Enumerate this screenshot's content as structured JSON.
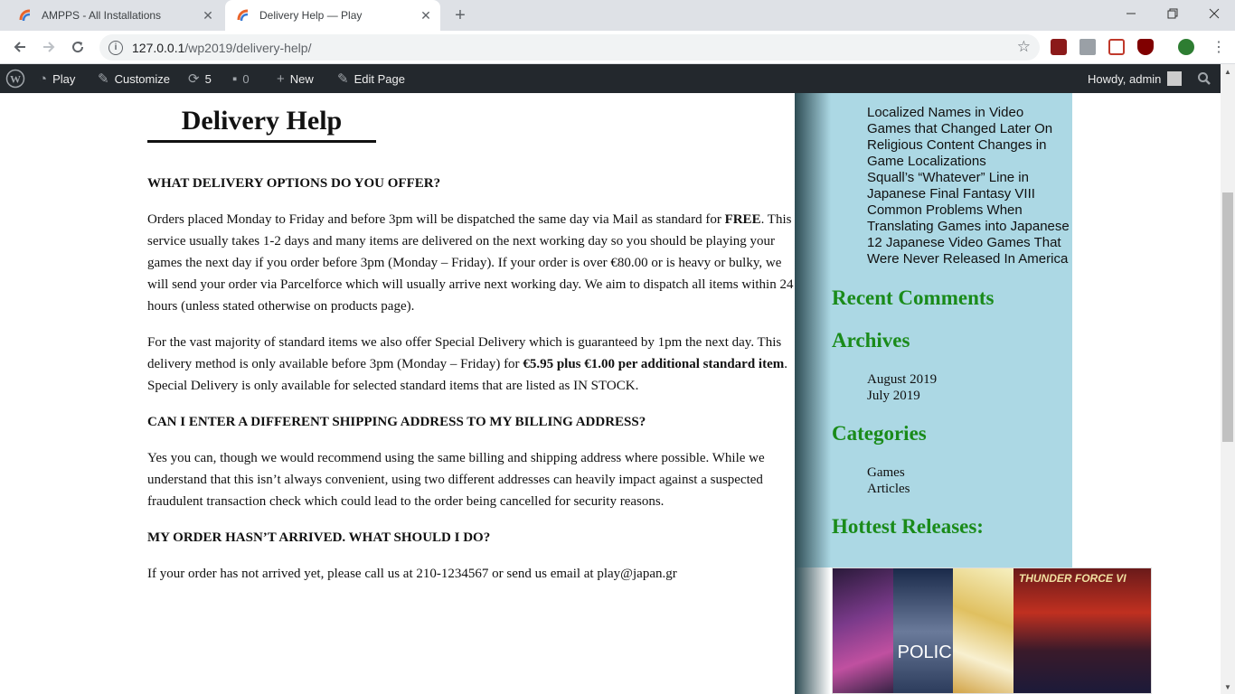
{
  "browser": {
    "tabs": [
      {
        "title": "AMPPS - All Installations"
      },
      {
        "title": "Delivery Help — Play"
      }
    ],
    "url_host": "127.0.0.1",
    "url_path": "/wp2019/delivery-help/"
  },
  "adminbar": {
    "site": "Play",
    "customize": "Customize",
    "updates": "5",
    "comments": "0",
    "new": "New",
    "edit": "Edit Page",
    "howdy": "Howdy, admin"
  },
  "page": {
    "title": "Delivery Help",
    "q1": "WHAT DELIVERY OPTIONS DO YOU OFFER?",
    "p1a": "Orders placed Monday to Friday and before 3pm will be dispatched the same day via Mail as standard for ",
    "p1b": "FREE",
    "p1c": ". This service usually takes 1-2 days and many items are delivered on the next working day so you should be playing your games the next day if you order before 3pm (Monday – Friday). If your order is over €80.00 or is heavy or bulky, we will send your order via Parcelforce which will usually arrive next working day. We aim to dispatch all items within 24 hours (unless stated otherwise on products page).",
    "p2a": "For the vast majority of standard items we also offer Special Delivery which is guaranteed by 1pm the next day. This delivery method is only available before 3pm (Monday – Friday) for ",
    "p2b": "€5.95 plus €1.00 per additional standard item",
    "p2c": ". Special Delivery is only available for selected standard items that are listed as IN STOCK.",
    "q2": "CAN I ENTER A DIFFERENT SHIPPING ADDRESS TO MY BILLING ADDRESS?",
    "p3": "Yes you can, though we would recommend using the same billing and shipping address where possible. While we understand that this isn’t always convenient, using two different addresses can heavily impact against a suspected fraudulent transaction check which could lead to the order being cancelled for security reasons.",
    "q3": "MY ORDER HASN’T ARRIVED. WHAT SHOULD I DO?",
    "p4": "If your order has not arrived yet, please call us at 210-1234567 or send us email at play@japan.gr"
  },
  "sidebar": {
    "recent_posts": [
      "Localized Names in Video Games that Changed Later On",
      "Religious Content Changes in Game Localizations",
      "Squall’s “Whatever” Line in Japanese Final Fantasy VIII",
      "Common Problems When Translating Games into Japanese",
      "12 Japanese Video Games That Were Never Released In America"
    ],
    "recent_comments_heading": "Recent Comments",
    "archives_heading": "Archives",
    "archives": [
      "August 2019",
      "July 2019"
    ],
    "categories_heading": "Categories",
    "categories": [
      "Games",
      "Articles"
    ],
    "hottest_heading": "Hottest Releases:",
    "cover_texts": [
      "POLIC",
      "THUNDER FORCE VI"
    ]
  },
  "colors": {
    "sidebar_bg": "#acd8e4",
    "heading_green": "#1a8b1a",
    "adminbar_bg": "#23282d"
  }
}
